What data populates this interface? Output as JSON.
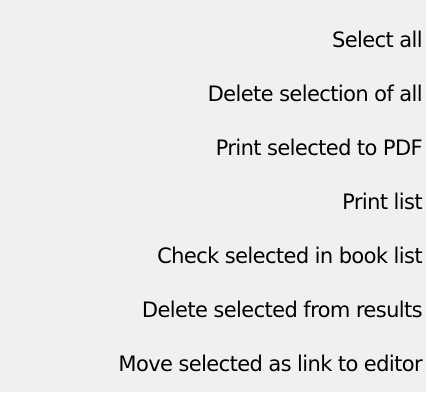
{
  "context_menu": {
    "items": [
      {
        "label": "Select all"
      },
      {
        "label": "Delete selection of all"
      },
      {
        "label": "Print selected to PDF"
      },
      {
        "label": "Print list"
      },
      {
        "label": "Check selected in book list"
      },
      {
        "label": "Delete selected from results"
      },
      {
        "label": "Move selected as link to editor"
      }
    ]
  },
  "colors": {
    "menu_background": "#f0f0f0",
    "text": "#000000"
  }
}
